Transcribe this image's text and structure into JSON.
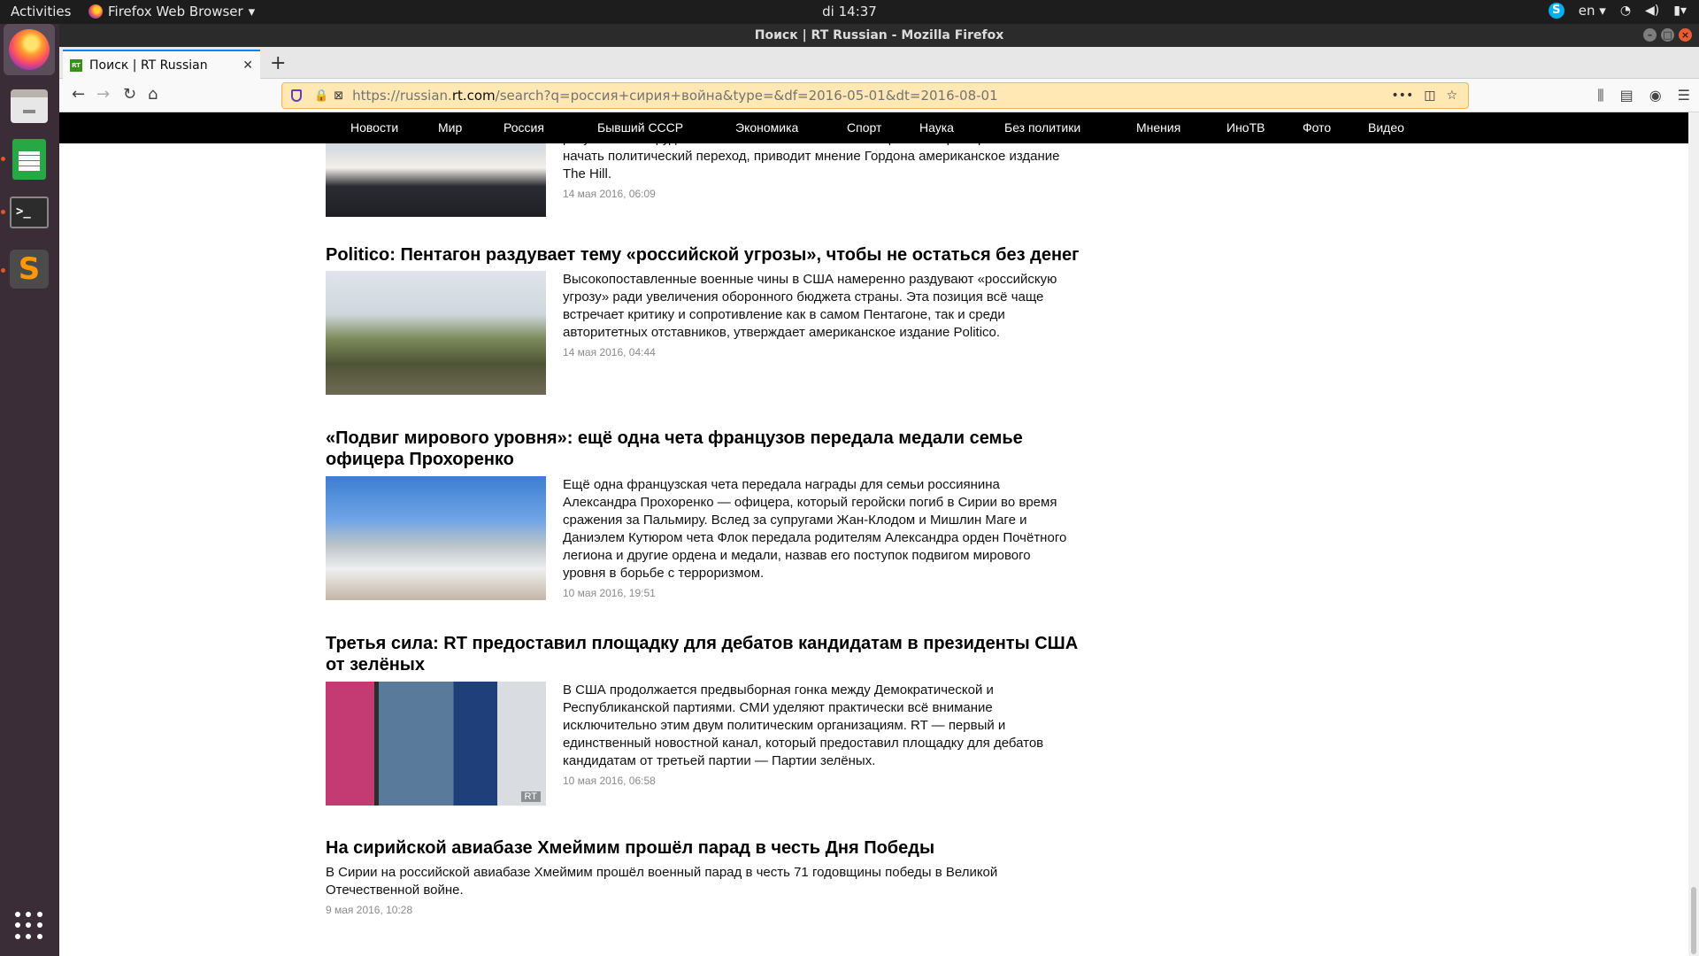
{
  "topbar": {
    "activities": "Activities",
    "app_name": "Firefox Web Browser",
    "clock": "di 14:37",
    "language": "en"
  },
  "window": {
    "title": "Поиск | RT Russian - Mozilla Firefox"
  },
  "tab": {
    "favicon_text": "RT",
    "title": "Поиск | RT Russian"
  },
  "urlbar": {
    "scheme": "https://russian.",
    "host": "rt.com",
    "path": "/search?q=россия+сирия+война&type=&df=2016-05-01&dt=2016-08-01"
  },
  "site_nav": {
    "items": [
      "Новости",
      "Мир",
      "Россия",
      "Бывший СССР",
      "Экономика",
      "Спорт",
      "Наука",
      "Без политики",
      "Мнения",
      "ИноТВ",
      "Фото",
      "Видео"
    ]
  },
  "articles": [
    {
      "headline": "",
      "teaser": "разумнее в сотрудничестве с Россией восстановить режим перемирия и затем начать политический переход, приводит мнение Гордона американское издание The Hill.",
      "date": "14 мая 2016, 06:09",
      "has_image": true
    },
    {
      "headline": "Politico: Пентагон раздувает тему «российской угрозы», чтобы не остаться без денег",
      "teaser": "Высокопоставленные военные чины в США намеренно раздувают «российскую угрозу» ради увеличения оборонного бюджета страны. Эта позиция всё чаще встречает критику и сопротивление как в самом Пентагоне, так и среди авторитетных отставников, утверждает американское издание Politico.",
      "date": "14 мая 2016, 04:44",
      "has_image": true
    },
    {
      "headline": "«Подвиг мирового уровня»: ещё одна чета французов передала медали семье офицера Прохоренко",
      "teaser": "Ещё одна французская чета передала награды для семьи россиянина Александра Прохоренко — офицера, который геройски погиб в Сирии во время сражения за Пальмиру. Вслед за супругами Жан-Клодом и Мишлин Маге и Даниэлем Кутюром чета Флок передала родителям Александра орден Почётного легиона и другие ордена и медали, назвав его поступок подвигом мирового уровня в борьбе с терроризмом.",
      "date": "10 мая 2016, 19:51",
      "has_image": true
    },
    {
      "headline": "Третья сила: RT предоставил площадку для дебатов кандидатам в президенты США от зелёных",
      "teaser": "В США продолжается предвыборная гонка между Демократической и Республиканской партиями. СМИ уделяют практически всё внимание исключительно этим двум политическим организациям. RT — первый и единственный новостной канал, который предоставил площадку для дебатов кандидатам от третьей партии — Партии зелёных.",
      "date": "10 мая 2016, 06:58",
      "has_image": true,
      "image_text": "RT"
    },
    {
      "headline": "На сирийской авиабазе Хмеймим прошёл парад в честь Дня Победы",
      "teaser": "В Сирии на российской авиабазе Хмеймим прошёл военный парад в честь 71 годовщины победы в Великой Отечественной войне.",
      "date": "9 мая 2016, 10:28",
      "has_image": false
    }
  ],
  "colors": {
    "urlbar_bg": "#ffe8b3",
    "site_nav_bg": "#000000",
    "accent_tab": "#0a84ff",
    "dock_bg": "#3a2d38"
  }
}
